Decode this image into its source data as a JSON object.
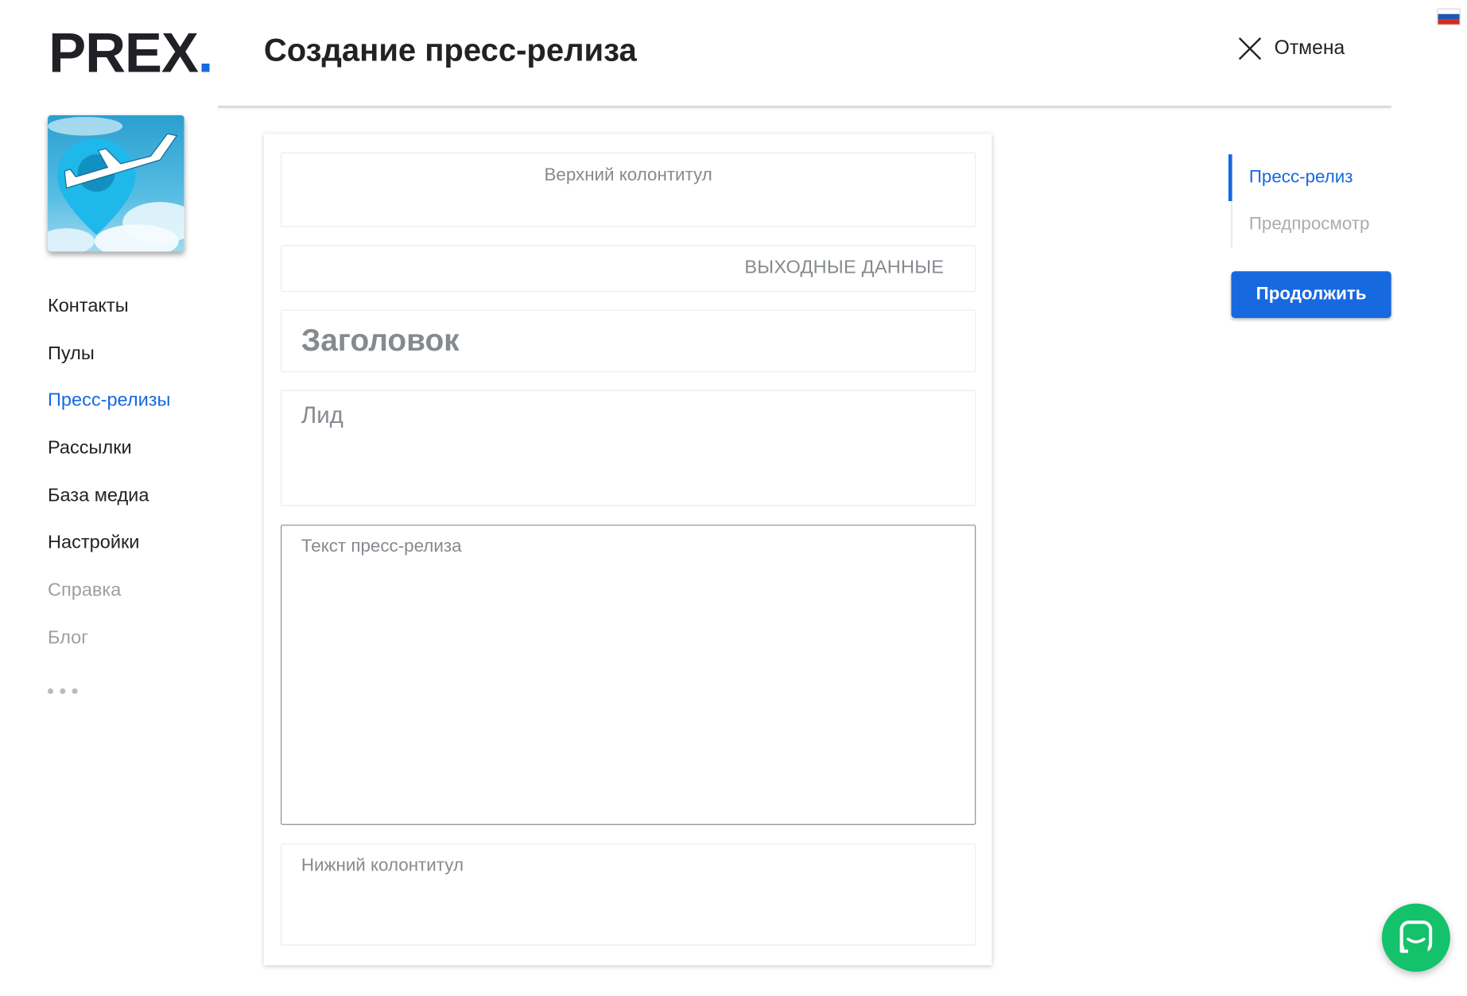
{
  "logo": {
    "text": "PREX",
    "dot": "."
  },
  "header": {
    "title": "Создание пресс-релиза",
    "cancel_label": "Отмена"
  },
  "language_flag": "russia-flag-icon",
  "sidebar": {
    "avatar": "airplane-location-logo",
    "items": [
      {
        "label": "Контакты",
        "state": "normal"
      },
      {
        "label": "Пулы",
        "state": "normal"
      },
      {
        "label": "Пресс-релизы",
        "state": "active"
      },
      {
        "label": "Рассылки",
        "state": "normal"
      },
      {
        "label": "База медиа",
        "state": "normal"
      },
      {
        "label": "Настройки",
        "state": "normal"
      },
      {
        "label": "Справка",
        "state": "muted"
      },
      {
        "label": "Блог",
        "state": "muted"
      }
    ]
  },
  "editor": {
    "header_placeholder": "Верхний колонтитул",
    "output_placeholder": "ВЫХОДНЫЕ ДАННЫЕ",
    "title_placeholder": "Заголовок",
    "lead_placeholder": "Лид",
    "body_placeholder": "Текст пресс-релиза",
    "footer_placeholder": "Нижний колонтитул"
  },
  "steps": [
    {
      "label": "Пресс-релиз",
      "active": true
    },
    {
      "label": "Предпросмотр",
      "active": false
    }
  ],
  "continue_label": "Продолжить",
  "colors": {
    "accent": "#1769e0",
    "chat": "#13c26b",
    "text": "#222222",
    "muted": "#9aa0a6"
  }
}
